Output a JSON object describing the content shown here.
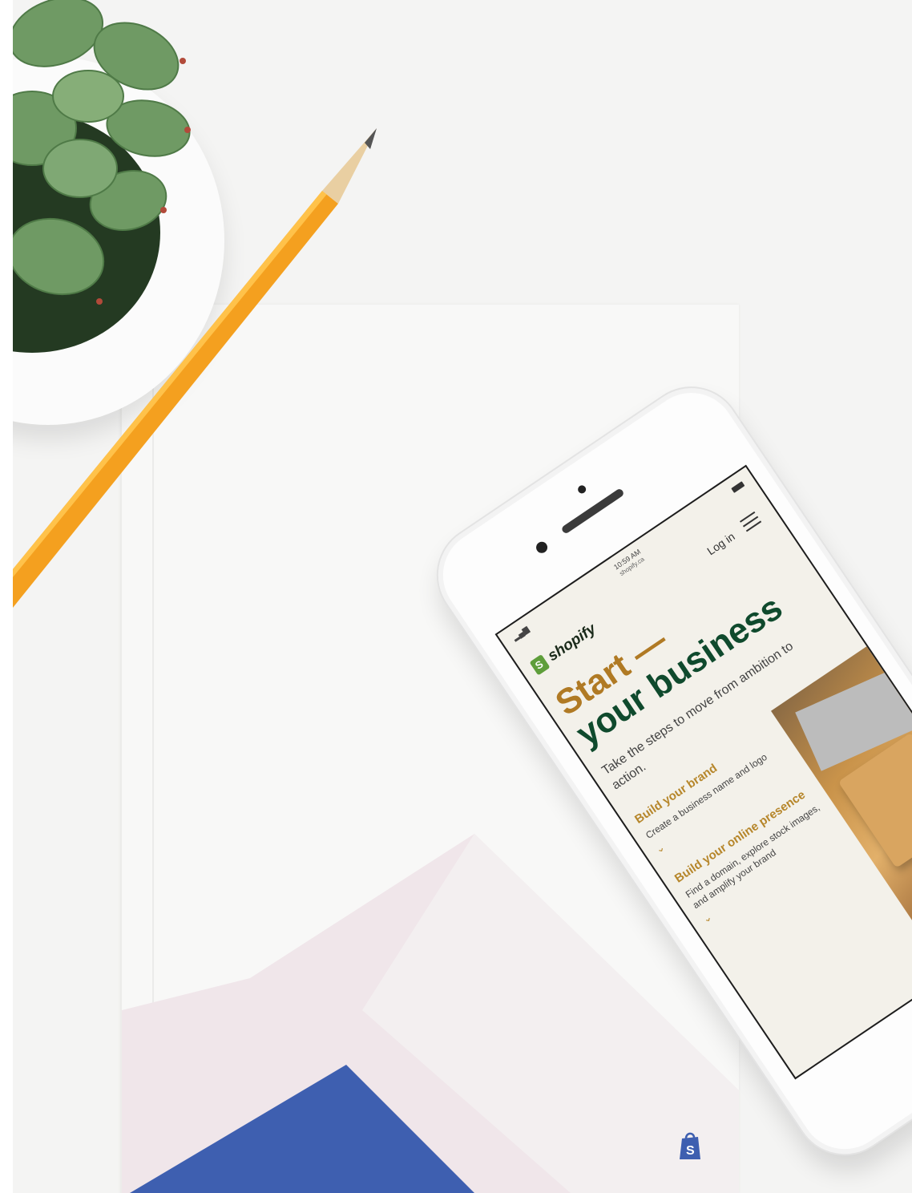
{
  "status_bar": {
    "time": "10:59 AM",
    "url": "shopify.ca"
  },
  "nav": {
    "brand": "shopify",
    "login": "Log in"
  },
  "hero": {
    "headline_part1": "Start —",
    "headline_part2": "your business",
    "subtext": "Take the steps to move from ambition to action."
  },
  "steps": [
    {
      "title": "Build your brand",
      "description": "Create a business name and logo"
    },
    {
      "title": "Build your online presence",
      "description": "Find a domain, explore stock images, and amplify your brand"
    }
  ],
  "colors": {
    "accent_gold": "#b07a24",
    "brand_green": "#0f4a2d",
    "shopify_green": "#5e9e3a",
    "notebook_blue": "#3e5fb0",
    "pencil_orange": "#f4a01f"
  },
  "icons": [
    "menu-icon",
    "chevron-down-icon",
    "shopify-bag-icon",
    "signal-icon",
    "battery-icon"
  ]
}
